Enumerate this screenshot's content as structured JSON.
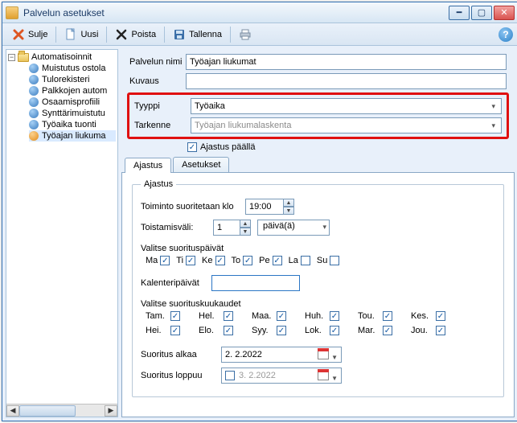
{
  "window": {
    "title": "Palvelun asetukset"
  },
  "toolbar": {
    "close": "Sulje",
    "new": "Uusi",
    "delete": "Poista",
    "save": "Tallenna"
  },
  "tree": {
    "root": "Automatisoinnit",
    "items": [
      {
        "label": "Muistutus ostola",
        "color": "blue"
      },
      {
        "label": "Tulorekisteri",
        "color": "blue"
      },
      {
        "label": "Palkkojen autom",
        "color": "blue"
      },
      {
        "label": "Osaamisprofiili",
        "color": "blue"
      },
      {
        "label": "Synttärimuistutu",
        "color": "blue"
      },
      {
        "label": "Työaika tuonti",
        "color": "blue"
      },
      {
        "label": "Työajan liukuma",
        "color": "orange",
        "selected": true
      }
    ]
  },
  "form": {
    "name_label": "Palvelun nimi",
    "name_value": "Työajan liukumat",
    "desc_label": "Kuvaus",
    "desc_value": "",
    "type_label": "Tyyppi",
    "type_value": "Työaika",
    "detail_label": "Tarkenne",
    "detail_value": "Työajan liukumalaskenta",
    "sched_on_label": "Ajastus päällä",
    "sched_on_checked": true
  },
  "tabs": {
    "tab1": "Ajastus",
    "tab2": "Asetukset",
    "active": 0
  },
  "schedule": {
    "legend": "Ajastus",
    "exec_at_label": "Toiminto suoritetaan klo",
    "exec_at_value": "19:00",
    "repeat_label": "Toistamisväli:",
    "repeat_value": "1",
    "repeat_unit": "päivä(ä)",
    "choose_days_label": "Valitse suorituspäivät",
    "days": [
      {
        "abbr": "Ma",
        "checked": true
      },
      {
        "abbr": "Ti",
        "checked": true
      },
      {
        "abbr": "Ke",
        "checked": true
      },
      {
        "abbr": "To",
        "checked": true
      },
      {
        "abbr": "Pe",
        "checked": true
      },
      {
        "abbr": "La",
        "checked": false
      },
      {
        "abbr": "Su",
        "checked": false
      }
    ],
    "calendar_days_label": "Kalenteripäivät",
    "calendar_days_value": "",
    "choose_months_label": "Valitse suorituskuukaudet",
    "months": [
      {
        "abbr": "Tam.",
        "checked": true
      },
      {
        "abbr": "Hel.",
        "checked": true
      },
      {
        "abbr": "Maa.",
        "checked": true
      },
      {
        "abbr": "Huh.",
        "checked": true
      },
      {
        "abbr": "Tou.",
        "checked": true
      },
      {
        "abbr": "Kes.",
        "checked": true
      },
      {
        "abbr": "Hei.",
        "checked": true
      },
      {
        "abbr": "Elo.",
        "checked": true
      },
      {
        "abbr": "Syy.",
        "checked": true
      },
      {
        "abbr": "Lok.",
        "checked": true
      },
      {
        "abbr": "Mar.",
        "checked": true
      },
      {
        "abbr": "Jou.",
        "checked": true
      }
    ],
    "start_label": "Suoritus alkaa",
    "start_value": "2.  2.2022",
    "end_label": "Suoritus loppuu",
    "end_enabled": false,
    "end_value": "3.  2.2022"
  }
}
